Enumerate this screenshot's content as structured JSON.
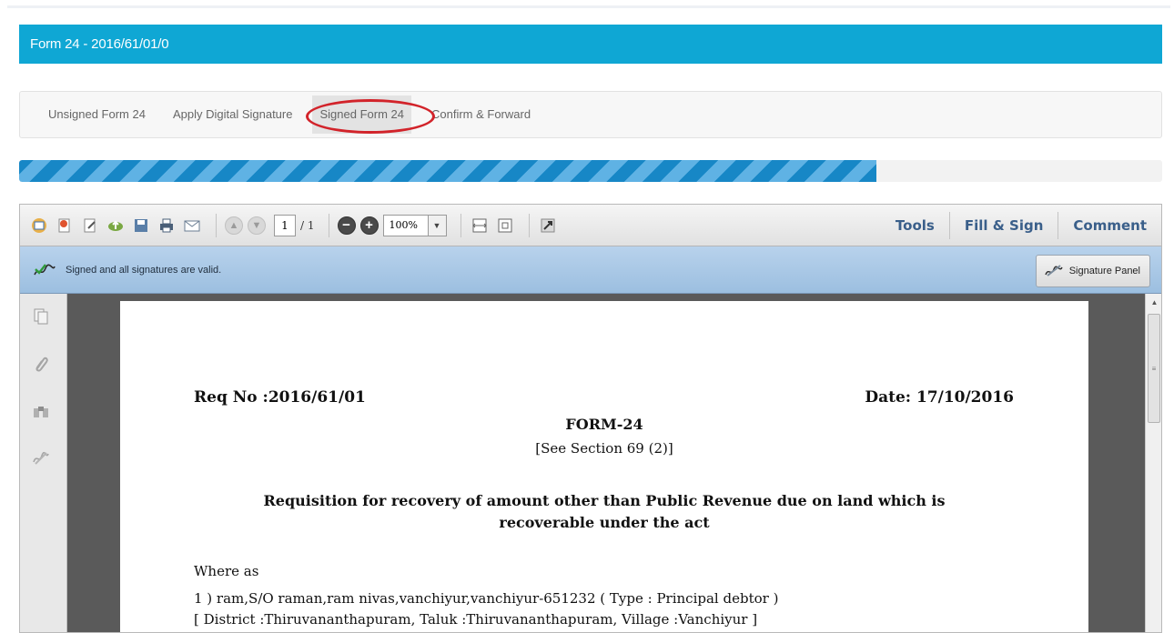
{
  "header": {
    "title": "Form 24 - 2016/61/01/0"
  },
  "tabs": [
    {
      "label": "Unsigned Form 24"
    },
    {
      "label": "Apply Digital Signature"
    },
    {
      "label": "Signed Form 24",
      "active": true
    },
    {
      "label": "Confirm & Forward"
    }
  ],
  "progress": {
    "percent": 75,
    "color": "#1787c6"
  },
  "viewer": {
    "toolbar": {
      "page_current": "1",
      "page_total": "/ 1",
      "zoom": "100%",
      "tools_label": "Tools",
      "fill_sign_label": "Fill & Sign",
      "comment_label": "Comment"
    },
    "signature_bar": {
      "status_text": "Signed and all signatures are valid.",
      "panel_button": "Signature Panel"
    }
  },
  "document": {
    "req_no": "Req No :2016/61/01",
    "date": "Date: 17/10/2016",
    "form_title": "FORM-24",
    "see_section": "[See Section 69 (2)]",
    "requisition_line1": "Requisition for recovery of amount other than Public Revenue due on land which is",
    "requisition_line2": "recoverable under the act",
    "where_as": "Where as",
    "line1": "1 ) ram,S/O raman,ram nivas,vanchiyur,vanchiyur-651232 ( Type : Principal debtor )",
    "line2": "[ District :Thiruvananthapuram, Taluk :Thiruvananthapuram, Village :Vanchiyur ]"
  },
  "colors": {
    "title_bar": "#0fa7d4",
    "highlight_circle": "#d2232a",
    "toolbar_link": "#3a5f8a"
  }
}
